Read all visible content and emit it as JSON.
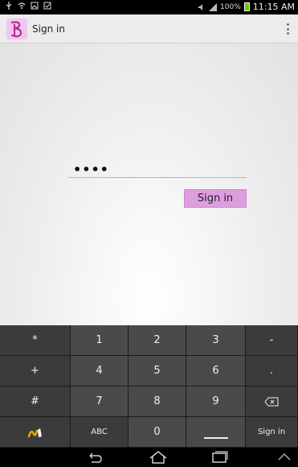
{
  "status_bar": {
    "battery_text": "100%",
    "time": "11:15 AM"
  },
  "action_bar": {
    "title": "Sign in"
  },
  "form": {
    "password_value": "••••",
    "sign_in_label": "Sign in"
  },
  "keyboard": {
    "rows": [
      [
        "*",
        "1",
        "2",
        "3",
        "-"
      ],
      [
        "+",
        "4",
        "5",
        "6",
        "."
      ],
      [
        "#",
        "7",
        "8",
        "9",
        "backspace"
      ],
      [
        "handwriting",
        "ABC",
        "0",
        "space",
        "Sign in"
      ]
    ],
    "row1": {
      "k1": "*",
      "k2": "1",
      "k3": "2",
      "k4": "3",
      "k5": "-"
    },
    "row2": {
      "k1": "+",
      "k2": "4",
      "k3": "5",
      "k4": "6",
      "k5": "."
    },
    "row3": {
      "k1": "#",
      "k2": "7",
      "k3": "8",
      "k4": "9"
    },
    "row4": {
      "k2": "ABC",
      "k3": "0",
      "k5": "Sign in"
    }
  },
  "colors": {
    "accent": "#dd9ee0",
    "field_underline": "#d59fd6",
    "keyboard_dark": "#3b3b3b",
    "keyboard_num": "#4a4a4a"
  },
  "icons": [
    "usb-icon",
    "wifi-icon",
    "image-icon",
    "checkbox-icon",
    "sound-icon",
    "signal-icon",
    "battery-icon",
    "overflow-menu-icon",
    "back-icon",
    "home-icon",
    "recent-apps-icon",
    "up-chevron-icon",
    "backspace-icon",
    "handwriting-icon"
  ]
}
